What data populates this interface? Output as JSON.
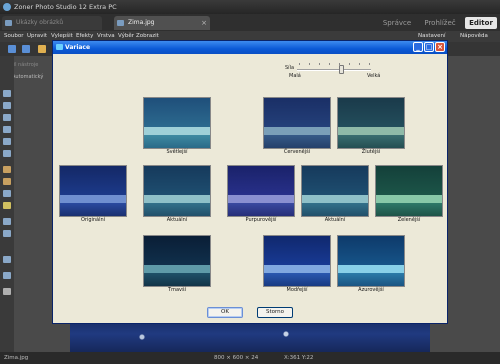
{
  "app": {
    "title": "Zoner Photo Studio 12 Extra PC"
  },
  "tabs": {
    "doc_tabs": [
      {
        "label": "Ukázky obrázků"
      },
      {
        "label": "Zima.jpg"
      }
    ],
    "modes": [
      {
        "label": "Správce"
      },
      {
        "label": "Prohlížeč"
      },
      {
        "label": "Editor"
      }
    ]
  },
  "menu": {
    "items": [
      "Soubor",
      "Upravit",
      "Vylepšit",
      "Efekty",
      "Vrstva",
      "Výběr",
      "Zobrazit"
    ],
    "right": [
      "Nastavení",
      "Nápověda"
    ]
  },
  "left_panel": {
    "label1": "Profil nástroje",
    "checkbox": "Automatický"
  },
  "dialog": {
    "title": "Variace",
    "strength_label": "Síla",
    "small_label": "Malá",
    "large_label": "Velká",
    "strength_level": 0.6,
    "buttons": {
      "ok": "OK",
      "cancel": "Storno"
    },
    "variations": [
      {
        "label": "Světlejší"
      },
      {
        "label": "Červenější"
      },
      {
        "label": "Žlutější"
      },
      {
        "label": "Originální"
      },
      {
        "label": "Aktuální"
      },
      {
        "label": "Purpurovější"
      },
      {
        "label": "Aktuální"
      },
      {
        "label": "Zelenější"
      },
      {
        "label": "Tmavší"
      },
      {
        "label": "Modřejší"
      },
      {
        "label": "Azurovější"
      }
    ]
  },
  "status": {
    "filename": "Zima.jpg",
    "dimensions": "800 × 600 × 24",
    "coords": "X:361 Y:22"
  }
}
